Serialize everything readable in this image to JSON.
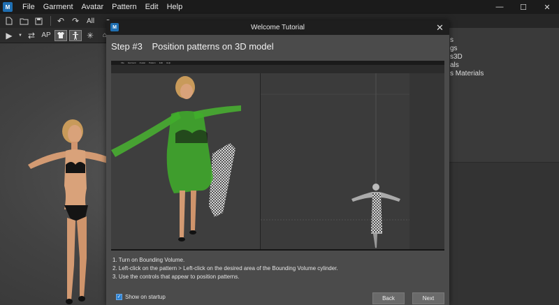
{
  "menubar": {
    "items": [
      "File",
      "Garment",
      "Avatar",
      "Pattern",
      "Edit",
      "Help"
    ],
    "window_controls": {
      "minimize": "—",
      "maximize": "☐",
      "close": "✕"
    }
  },
  "toolbar1": {
    "icons": [
      "new-file-icon",
      "open-folder-icon",
      "save-icon",
      "undo-icon",
      "redo-icon"
    ],
    "select_value": "All"
  },
  "toolbar2": {
    "label_ap": "AP",
    "icons": [
      "play-icon",
      "swap-icon",
      "garment-icon",
      "avatar-icon",
      "sparkle-icon"
    ]
  },
  "right_panel": {
    "items": [
      "s",
      "gs",
      "s3D",
      "als",
      "s Materials"
    ]
  },
  "dialog": {
    "title": "Welcome Tutorial",
    "close_label": "✕",
    "step_number": "Step #3",
    "step_title": "Position patterns on 3D model",
    "instructions": [
      "1. Turn on Bounding Volume.",
      "2. Left-click on the pattern > Left-click on the desired area of the Bounding Volume cylinder.",
      "3. Use the controls that appear to position patterns."
    ],
    "show_on_startup_label": "Show on startup",
    "show_on_startup_checked": true,
    "back_label": "Back",
    "next_label": "Next"
  },
  "tutorial_image": {
    "menu_items": [
      "File",
      "Garment",
      "Avatar",
      "Pattern",
      "Edit",
      "Help"
    ]
  },
  "colors": {
    "accent": "#2d82d2",
    "garment_green": "#3fae2a",
    "skin": "#d9a27a"
  }
}
